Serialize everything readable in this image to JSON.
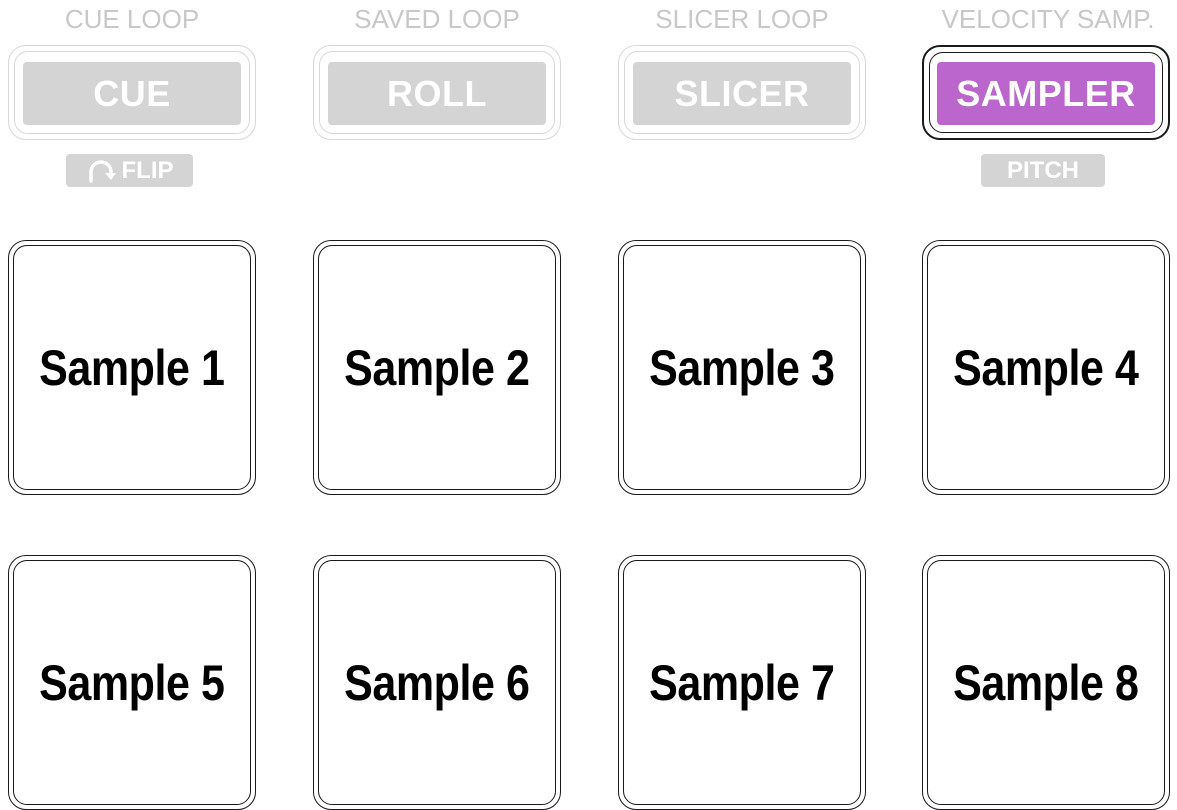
{
  "mode_columns": [
    {
      "shift_label": "CUE LOOP",
      "button_label": "CUE",
      "active": false
    },
    {
      "shift_label": "SAVED LOOP",
      "button_label": "ROLL",
      "active": false
    },
    {
      "shift_label": "SLICER LOOP",
      "button_label": "SLICER",
      "active": false
    },
    {
      "shift_label": "VELOCITY SAMP.",
      "button_label": "SAMPLER",
      "active": true
    }
  ],
  "badges": {
    "flip": {
      "label": "FLIP",
      "icon": "loop-arrow-icon"
    },
    "pitch": {
      "label": "PITCH"
    }
  },
  "pads": [
    {
      "label": "Sample 1"
    },
    {
      "label": "Sample 2"
    },
    {
      "label": "Sample 3"
    },
    {
      "label": "Sample 4"
    },
    {
      "label": "Sample 5"
    },
    {
      "label": "Sample 6"
    },
    {
      "label": "Sample 7"
    },
    {
      "label": "Sample 8"
    }
  ],
  "colors": {
    "active_mode": "#bb66cc",
    "inactive_mode": "#d4d4d4",
    "shift_label": "#c8c8c8",
    "pad_outline": "#1a1a1a"
  }
}
